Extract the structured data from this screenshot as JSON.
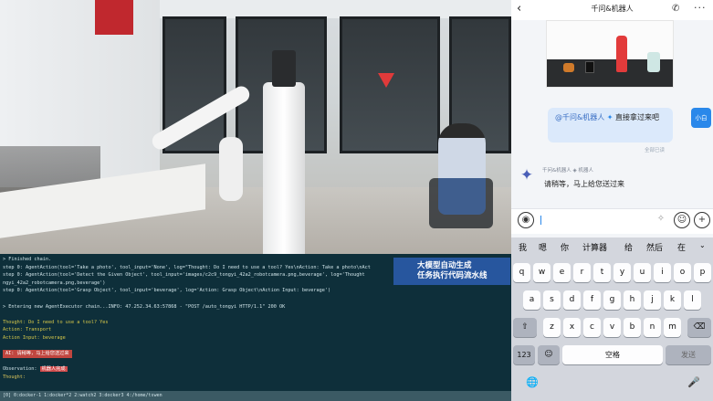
{
  "caption": {
    "line1": "大模型自动生成",
    "line2": "任务执行代码流水线"
  },
  "terminal": {
    "lines": [
      "> Finished chain.",
      "step 0: AgentAction(tool='Take a photo', tool_input='None', log=\"Thought: Do I need to use a tool? Yes\\nAction: Take a photo\\nAct",
      "step 0: AgentAction(tool='Detect the Given Object', tool_input='images/c2c9_tongyi_42a2_robotcamera.png,beverage', log='Thought",
      "ngyi_42a2_robotcamera.png,beverage')",
      "step 0: AgentAction(tool='Grasp Object', tool_input='beverage', log='Action: Grasp Object\\nAction Input: beverage')",
      "",
      "> Entering new AgentExecutor chain...INFO:     47.252.34.63:57868 - \"POST /auto_tongyi HTTP/1.1\" 200 OK",
      "",
      "Thought: Do I need to use a tool? Yes",
      "Action: Transport",
      "Action Input: beverage",
      ""
    ],
    "ai_reply": "AI: 请稍等，马上给您送过来",
    "observation_label": "Observation:",
    "observation_tag": "机器人完成",
    "thought_tail": "Thought:",
    "status": "[0] 0:docker-1  1:docker*2  2:watch2  3:docker3  4:/home/tswen"
  },
  "chat": {
    "title": "千问&机器人",
    "user_mention": "@千问&机器人",
    "user_message": "直接拿过来吧",
    "user_avatar_label": "小白",
    "read_status": "全部已读",
    "bot_name": "千问&机器人",
    "bot_badge": "机器人",
    "bot_message": "请稍等，马上给您送过来"
  },
  "keyboard": {
    "suggestions": [
      "我",
      "嗯",
      "你",
      "计算器",
      "给",
      "然后",
      "在"
    ],
    "row1": [
      "q",
      "w",
      "e",
      "r",
      "t",
      "y",
      "u",
      "i",
      "o",
      "p"
    ],
    "row2": [
      "a",
      "s",
      "d",
      "f",
      "g",
      "h",
      "j",
      "k",
      "l"
    ],
    "row3": [
      "z",
      "x",
      "c",
      "v",
      "b",
      "n",
      "m"
    ],
    "num_key": "123",
    "space_key": "空格",
    "send_key": "发送"
  },
  "colors": {
    "terminal_bg": "#0e2f3a",
    "caption_bg": "#2b5db0",
    "accent_blue": "#2a88ea",
    "bubble_user": "#dbe9fb",
    "alert_red": "#c0463f"
  }
}
